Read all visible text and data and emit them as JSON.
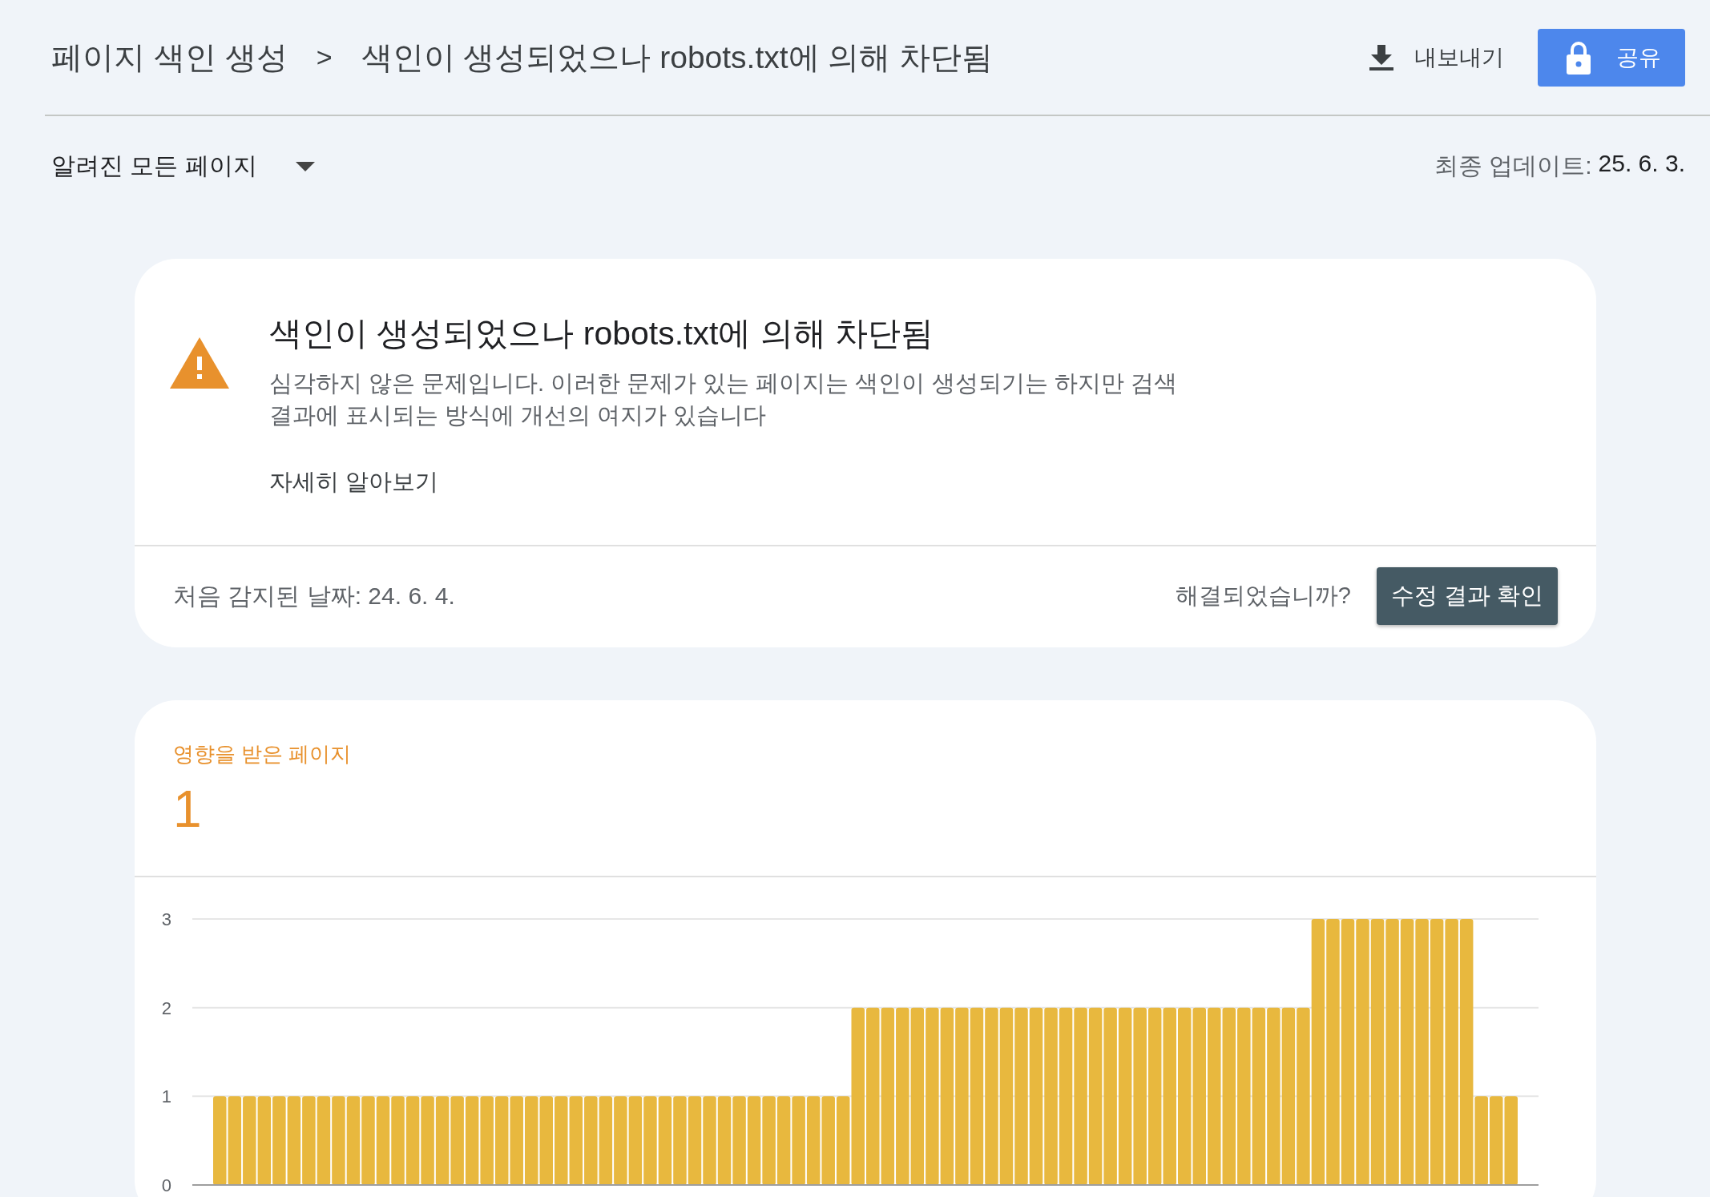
{
  "breadcrumb": {
    "parent": "페이지 색인 생성",
    "separator": ">",
    "current": "색인이 생성되었으나 robots.txt에 의해 차단됨"
  },
  "actions": {
    "export": "내보내기",
    "share": "공유"
  },
  "filter": {
    "label": "알려진 모든 페이지"
  },
  "last_updated": {
    "label": "최종 업데이트:",
    "value": "25. 6. 3."
  },
  "issue": {
    "title": "색인이 생성되었으나 robots.txt에 의해 차단됨",
    "description": "심각하지 않은 문제입니다. 이러한 문제가 있는 페이지는 색인이 생성되기는 하지만 검색결과에 표시되는 방식에 개선의 여지가 있습니다",
    "learn_more": "자세히 알아보기",
    "first_detected": "처음 감지된 날짜: 24. 6. 4.",
    "resolved_question": "해결되었습니까?",
    "validate_button": "수정 결과 확인"
  },
  "affected": {
    "label": "영향을 받은 페이지",
    "count": "1",
    "chart_data": {
      "type": "bar",
      "ylim": [
        0,
        3
      ],
      "yticks": [
        0,
        1,
        2,
        3
      ],
      "series": [
        {
          "color": "#e8b83e",
          "values": [
            1,
            1,
            1,
            1,
            1,
            1,
            1,
            1,
            1,
            1,
            1,
            1,
            1,
            1,
            1,
            1,
            1,
            1,
            1,
            1,
            1,
            1,
            1,
            1,
            1,
            1,
            1,
            1,
            1,
            1,
            1,
            1,
            1,
            1,
            1,
            1,
            1,
            1,
            1,
            1,
            1,
            1,
            1,
            2,
            2,
            2,
            2,
            2,
            2,
            2,
            2,
            2,
            2,
            2,
            2,
            2,
            2,
            2,
            2,
            2,
            2,
            2,
            2,
            2,
            2,
            2,
            2,
            2,
            2,
            2,
            2,
            2,
            2,
            2,
            3,
            3,
            3,
            3,
            3,
            3,
            3,
            3,
            3,
            3,
            3,
            1,
            1,
            1
          ]
        }
      ]
    }
  }
}
